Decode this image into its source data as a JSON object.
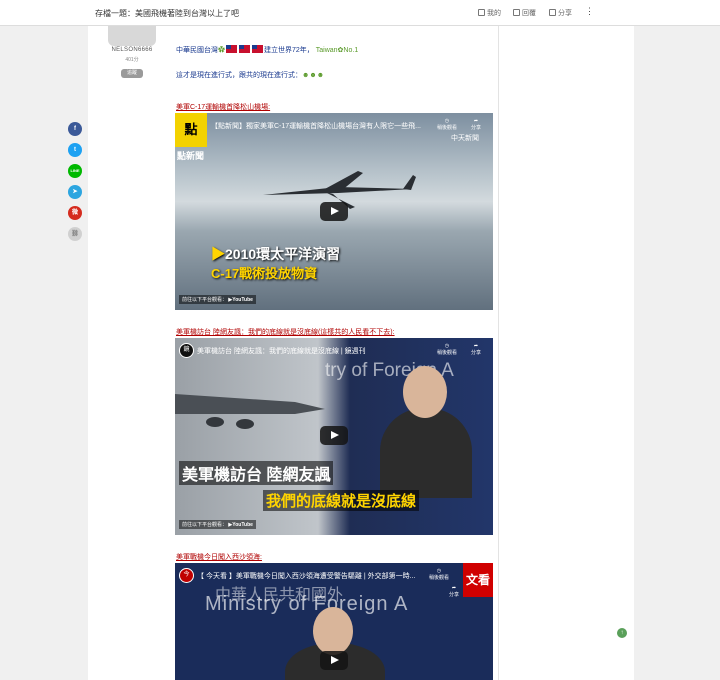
{
  "topbar": {
    "title": "存檔一題：美國飛機著陸到台灣以上了吧",
    "tools": [
      {
        "label": "我的",
        "icon": "bookmark-icon"
      },
      {
        "label": "回覆",
        "icon": "reply-icon"
      },
      {
        "label": "分享",
        "icon": "share-icon"
      }
    ],
    "more": "⋮"
  },
  "author": {
    "username": "NELSON6666",
    "points": "401分",
    "follow": "追蹤"
  },
  "share_bar": [
    {
      "name": "facebook",
      "glyph": "f",
      "color": "#3b5998"
    },
    {
      "name": "twitter",
      "glyph": "t",
      "color": "#1da1f2"
    },
    {
      "name": "line",
      "glyph": "LINE",
      "color": "#00b900"
    },
    {
      "name": "telegram",
      "glyph": "➤",
      "color": "#2ca5e0"
    },
    {
      "name": "weibo",
      "glyph": "微",
      "color": "#d52b1e"
    },
    {
      "name": "copy-link",
      "glyph": "⛓",
      "color": "#d0d0d0"
    }
  ],
  "post": {
    "line1_a": "中華民國台灣",
    "line1_b": "建立世界72年，",
    "line1_c": "Taiwan",
    "line1_d": "No.1",
    "line2": "這才是現在進行式，跟共的現在進行式：",
    "section1": "美軍C-17運輸機首降松山機場:",
    "section2": "美軍機訪台 陸網友諷：我們的底線就是沒底線(這樣共的人民看不下去):",
    "section3": "美軍戰機今日闖入西沙領海:"
  },
  "videos": [
    {
      "title": "【點新聞】獨家美軍C-17運輸機首降松山機場台灣有人限它一些飛...",
      "later": "稍後觀看",
      "share": "分享",
      "channel": "點",
      "badge": "點新聞",
      "watermark": "中天新聞",
      "caption_line1": "2010環太平洋演習",
      "caption_line2": "C-17戰術投放物資",
      "watch_on": "前往以下平台觀看：",
      "youtube": "YouTube"
    },
    {
      "title": "美軍機訪台 陸網友諷：我們的底線就是沒底線 | 鏡週刊",
      "later": "稍後觀看",
      "share": "分享",
      "channel": "鏡",
      "bg_text": "try of Foreign A",
      "caption_line1": "美軍機訪台 陸網友諷",
      "caption_line2": "我們的底線就是沒底線",
      "watch_on": "前往以下平台觀看：",
      "youtube": "YouTube"
    },
    {
      "title": "【 今天看 】美軍戰機今日闖入西沙領海遭受警告驅離 | 外交部第一時...",
      "later": "稍後觀看",
      "share": "分享",
      "channel": "今",
      "badge": "文看",
      "bg_text": "Ministry of Foreign A",
      "bg_text_top": "中華人民共和國外"
    }
  ],
  "colors": {
    "blue_text": "#1a3a8f",
    "red_text": "#b00000",
    "accent_green": "#5aa05a"
  }
}
